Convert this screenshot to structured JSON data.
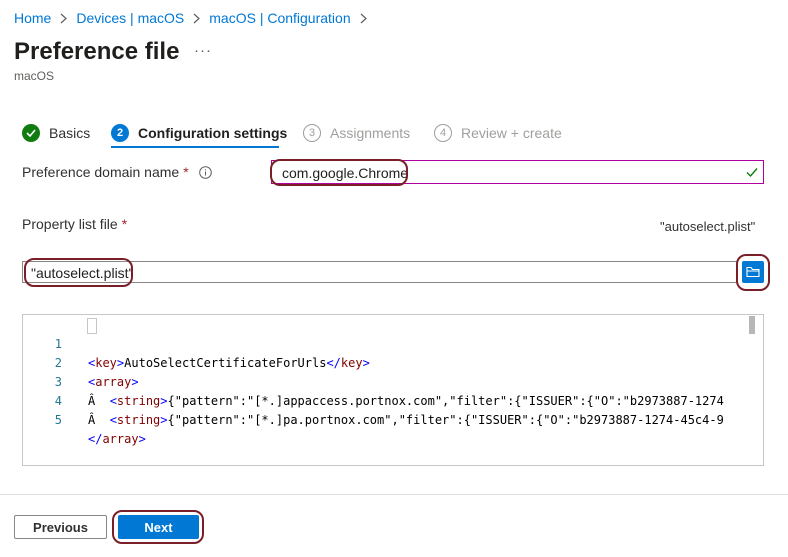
{
  "breadcrumb": [
    "Home",
    "Devices | macOS",
    "macOS | Configuration"
  ],
  "header": {
    "title": "Preference file",
    "more": "···",
    "subtitle": "macOS"
  },
  "steps": [
    {
      "number": "",
      "label": "Basics",
      "state": "complete"
    },
    {
      "number": "2",
      "label": "Configuration settings",
      "state": "active"
    },
    {
      "number": "3",
      "label": "Assignments",
      "state": "disabled"
    },
    {
      "number": "4",
      "label": "Review + create",
      "state": "disabled"
    }
  ],
  "form": {
    "domain_label": "Preference domain name",
    "required_mark": "*",
    "domain_value": "com.google.Chrome",
    "plist_label": "Property list file",
    "plist_selected_name": "\"autoselect.plist\"",
    "plist_input_value": "\"autoselect.plist\""
  },
  "editor": {
    "lines": [
      {
        "num": "1",
        "text": "<key>AutoSelectCertificateForUrls</key>"
      },
      {
        "num": "2",
        "text": "<array>"
      },
      {
        "num": "3",
        "text": "Â  <string>{\"pattern\":\"[*.]appaccess.portnox.com\",\"filter\":{\"ISSUER\":{\"O\":\"b2973887-1274"
      },
      {
        "num": "4",
        "text": "Â  <string>{\"pattern\":\"[*.]pa.portnox.com\",\"filter\":{\"ISSUER\":{\"O\":\"b2973887-1274-45c4-9"
      },
      {
        "num": "5",
        "text": "</array>"
      }
    ]
  },
  "footer": {
    "previous_label": "Previous",
    "next_label": "Next"
  },
  "colors": {
    "accent": "#0078d4",
    "success": "#107c10",
    "highlight": "#7a1e28",
    "focus_border": "#b4009e"
  }
}
